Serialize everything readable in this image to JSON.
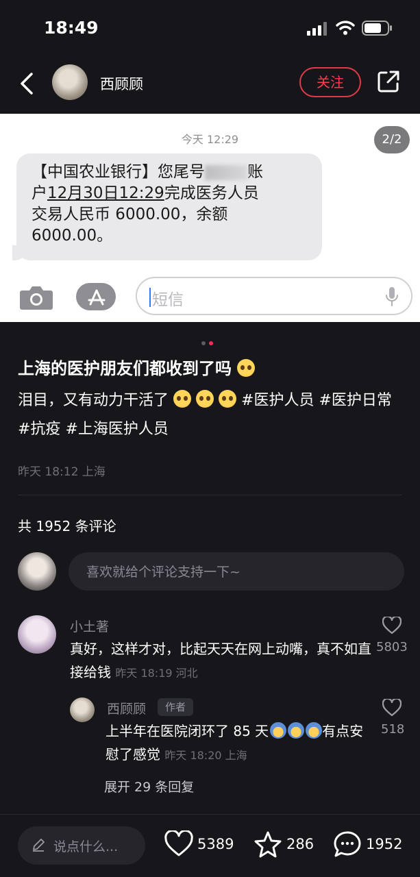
{
  "status_bar": {
    "time": "18:49"
  },
  "header": {
    "author": "西顾顾",
    "follow_label": "关注"
  },
  "sms": {
    "timestamp": "今天 12:29",
    "page_indicator": "2/2",
    "message_line1_a": "【中国农业银行】您尾号",
    "message_line1_b": "账",
    "message_line2_a": "户",
    "message_line2_date": "12月30日12:29",
    "message_line2_b": "完成医务人员",
    "message_line3": "交易人民币 6000.00，余额",
    "message_line4": "6000.00。",
    "input_placeholder": "短信"
  },
  "post": {
    "title": "上海的医护朋友们都收到了吗",
    "body_text": "泪目，又有动力干活了",
    "tags": [
      "#医护人员",
      "#医护日常",
      "#抗疫",
      "#上海医护人员"
    ],
    "meta": "昨天 18:12 上海",
    "comment_count": "共 1952 条评论",
    "comment_placeholder": "喜欢就给个评论支持一下~"
  },
  "comments": [
    {
      "user": "小土著",
      "text": "真好，这样才对，比起天天在网上动嘴，真不如直接给钱",
      "meta": "昨天 18:19 河北",
      "likes": "5803",
      "reply": {
        "user": "西顾顾",
        "badge": "作者",
        "text_a": "上半年在医院闭环了 85 天",
        "text_b": "有点安慰了感觉",
        "meta": "昨天 18:20 上海",
        "likes": "518"
      },
      "expand_label": "展开 29 条回复"
    }
  ],
  "bottom_bar": {
    "say_placeholder": "说点什么...",
    "likes": "5389",
    "favorites": "286",
    "comments": "1952"
  },
  "colors": {
    "accent": "#fe2c55",
    "background": "#17171b"
  },
  "icons": [
    "signal-icon",
    "wifi-icon",
    "battery-icon",
    "back-icon",
    "share-icon",
    "camera-icon",
    "app-store-icon",
    "microphone-icon",
    "heart-icon",
    "star-icon",
    "comment-icon",
    "pencil-icon"
  ]
}
